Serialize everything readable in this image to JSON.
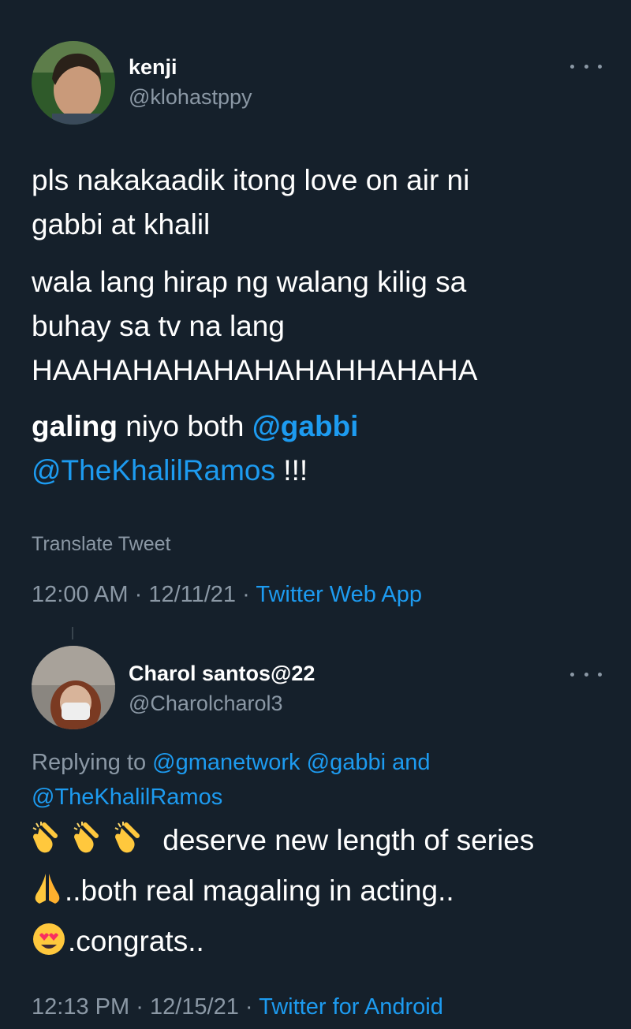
{
  "tweet1": {
    "display_name": "kenji",
    "handle": "@klohastppy",
    "para1": "pls nakakaadik itong love on air ni gabbi at khalil",
    "para1_line1": "pls nakakaadik itong love on air ni",
    "para1_line2": "gabbi at khalil",
    "para2_line1": "wala lang hirap ng walang kilig sa",
    "para2_line2": "buhay sa tv na lang",
    "para2_line3": "HAAHAHAHAHAHAHAHHAHAHA",
    "para3_bold": "galing",
    "para3_text": " niyo both ",
    "para3_mention1": "@gabbi",
    "para3_mention2": "@TheKhalilRamos",
    "para3_end": " !!!",
    "translate": "Translate Tweet",
    "time": "12:00 AM",
    "date": "12/11/21",
    "sep": "·",
    "source": "Twitter Web App"
  },
  "tweet2": {
    "display_name": "Charol santos@22",
    "handle": "@Charolcharol3",
    "replying_prefix": "Replying to ",
    "reply_mention1": "@gmanetwork",
    "reply_mention2": "@gabbi",
    "reply_and": " and",
    "reply_mention3": "@TheKhalilRamos",
    "line1": " deserve new length of series",
    "line2": "..both real magaling in acting..",
    "line3": ".congrats..",
    "time": "12:13 PM",
    "date": "12/15/21",
    "sep": "·",
    "source": "Twitter for Android"
  },
  "icons": {
    "more": "more-horizontal-icon",
    "clap": "clapping-hands-emoji",
    "pray": "folded-hands-emoji",
    "heart_eyes": "heart-eyes-emoji"
  },
  "colors": {
    "background": "#15202b",
    "text": "#ffffff",
    "secondary": "#8b98a5",
    "link": "#1d9bf0"
  }
}
